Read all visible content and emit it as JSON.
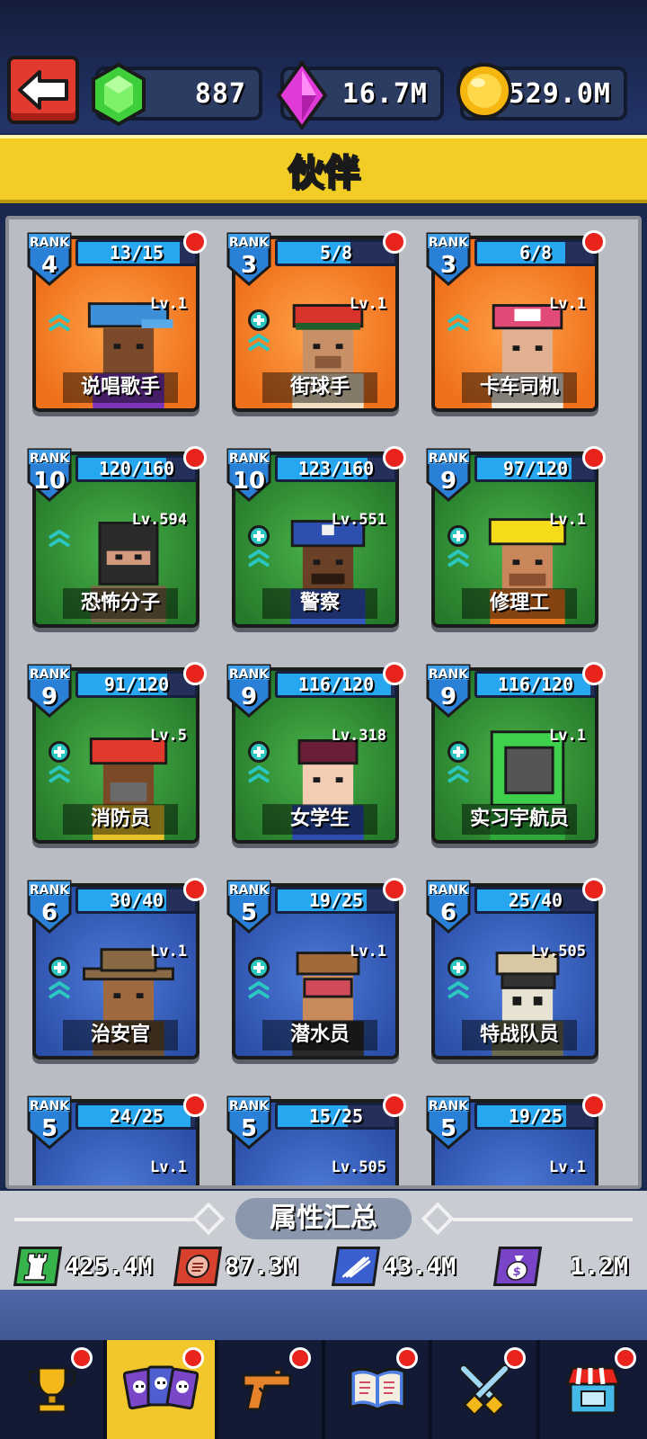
{
  "header": {
    "gems": "887",
    "crystals": "16.7M",
    "coins": "529.0M"
  },
  "title": "伙伴",
  "cards": [
    {
      "rank_label": "RANK",
      "rank": "4",
      "progress": "13/15",
      "progress_ratio": 0.87,
      "level": "Lv.1",
      "name": "说唱歌手",
      "bg": "orange",
      "plus": false,
      "chevrons": 1,
      "figure": "rapper"
    },
    {
      "rank_label": "RANK",
      "rank": "3",
      "progress": "5/8",
      "progress_ratio": 0.62,
      "level": "Lv.1",
      "name": "街球手",
      "bg": "orange",
      "plus": true,
      "chevrons": 1,
      "figure": "baller"
    },
    {
      "rank_label": "RANK",
      "rank": "3",
      "progress": "6/8",
      "progress_ratio": 0.75,
      "level": "Lv.1",
      "name": "卡车司机",
      "bg": "orange",
      "plus": false,
      "chevrons": 1,
      "figure": "trucker"
    },
    {
      "rank_label": "RANK",
      "rank": "10",
      "progress": "120/160",
      "progress_ratio": 0.75,
      "level": "Lv.594",
      "name": "恐怖分子",
      "bg": "green",
      "plus": false,
      "chevrons": 2,
      "figure": "terrorist"
    },
    {
      "rank_label": "RANK",
      "rank": "10",
      "progress": "123/160",
      "progress_ratio": 0.77,
      "level": "Lv.551",
      "name": "警察",
      "bg": "green",
      "plus": true,
      "chevrons": 2,
      "figure": "police"
    },
    {
      "rank_label": "RANK",
      "rank": "9",
      "progress": "97/120",
      "progress_ratio": 0.81,
      "level": "Lv.1",
      "name": "修理工",
      "bg": "green",
      "plus": true,
      "chevrons": 2,
      "figure": "repairman"
    },
    {
      "rank_label": "RANK",
      "rank": "9",
      "progress": "91/120",
      "progress_ratio": 0.76,
      "level": "Lv.5",
      "name": "消防员",
      "bg": "green",
      "plus": true,
      "chevrons": 2,
      "figure": "firefighter"
    },
    {
      "rank_label": "RANK",
      "rank": "9",
      "progress": "116/120",
      "progress_ratio": 0.97,
      "level": "Lv.318",
      "name": "女学生",
      "bg": "green",
      "plus": true,
      "chevrons": 2,
      "figure": "schoolgirl"
    },
    {
      "rank_label": "RANK",
      "rank": "9",
      "progress": "116/120",
      "progress_ratio": 0.97,
      "level": "Lv.1",
      "name": "实习宇航员",
      "bg": "green",
      "plus": true,
      "chevrons": 2,
      "figure": "astronaut"
    },
    {
      "rank_label": "RANK",
      "rank": "6",
      "progress": "30/40",
      "progress_ratio": 0.75,
      "level": "Lv.1",
      "name": "治安官",
      "bg": "blue",
      "plus": true,
      "chevrons": 1,
      "figure": "sheriff"
    },
    {
      "rank_label": "RANK",
      "rank": "5",
      "progress": "19/25",
      "progress_ratio": 0.76,
      "level": "Lv.1",
      "name": "潜水员",
      "bg": "blue",
      "plus": true,
      "chevrons": 1,
      "figure": "diver"
    },
    {
      "rank_label": "RANK",
      "rank": "6",
      "progress": "25/40",
      "progress_ratio": 0.62,
      "level": "Lv.505",
      "name": "特战队员",
      "bg": "blue",
      "plus": true,
      "chevrons": 1,
      "figure": "commando"
    },
    {
      "rank_label": "RANK",
      "rank": "5",
      "progress": "24/25",
      "progress_ratio": 0.96,
      "level": "Lv.1",
      "name": "",
      "bg": "blue",
      "plus": false,
      "chevrons": 0,
      "figure": "none"
    },
    {
      "rank_label": "RANK",
      "rank": "5",
      "progress": "15/25",
      "progress_ratio": 0.6,
      "level": "Lv.505",
      "name": "",
      "bg": "blue",
      "plus": false,
      "chevrons": 0,
      "figure": "none"
    },
    {
      "rank_label": "RANK",
      "rank": "5",
      "progress": "19/25",
      "progress_ratio": 0.76,
      "level": "Lv.1",
      "name": "",
      "bg": "blue",
      "plus": false,
      "chevrons": 0,
      "figure": "none"
    }
  ],
  "stats": {
    "title": "属性汇总",
    "items": [
      {
        "icon": "tower-icon",
        "value": "425.4M",
        "color": "#36b34a"
      },
      {
        "icon": "fist-icon",
        "value": "87.3M",
        "color": "#d8412e"
      },
      {
        "icon": "auto-icon",
        "value": "43.4M",
        "color": "#3b5fcf"
      },
      {
        "icon": "money-bag-icon",
        "value": "1.2M",
        "color": "#7a44c9"
      }
    ]
  },
  "nav": [
    {
      "icon": "trophy-icon",
      "active": false
    },
    {
      "icon": "cards-icon",
      "active": true
    },
    {
      "icon": "pistol-icon",
      "active": false
    },
    {
      "icon": "book-icon",
      "active": false
    },
    {
      "icon": "crossed-swords-icon",
      "active": false
    },
    {
      "icon": "shop-icon",
      "active": false
    }
  ],
  "colors": {
    "title_bar": "#f2cd25",
    "progress_fill": "#27a7f0",
    "rank_shield": "#2a7fd6",
    "notification": "#e8241c"
  }
}
